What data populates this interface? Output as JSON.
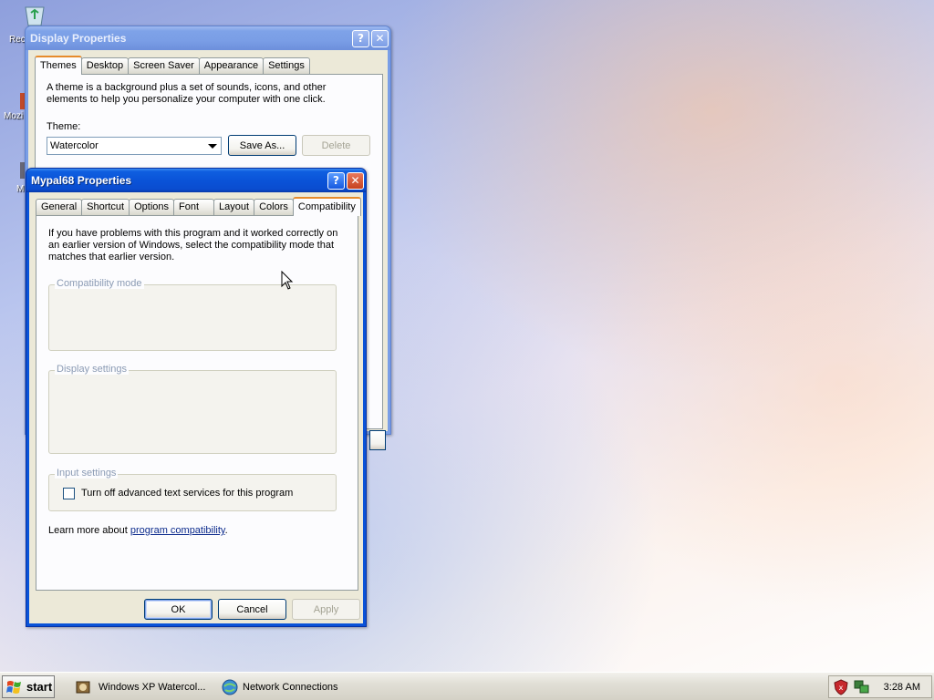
{
  "desktop": {
    "icons": [
      {
        "label": "Rec",
        "icon": "recycle-bin-icon"
      },
      {
        "label": "Mozi",
        "icon": "browser-icon"
      },
      {
        "label": "M",
        "icon": "shortcut-icon"
      }
    ]
  },
  "display_properties": {
    "title": "Display Properties",
    "tabs": [
      "Themes",
      "Desktop",
      "Screen Saver",
      "Appearance",
      "Settings"
    ],
    "selected_tab": "Themes",
    "description": "A theme is a background plus a set of sounds, icons, and other elements to help you personalize your computer with one click.",
    "theme_label": "Theme:",
    "theme_value": "Watercolor",
    "save_as_label": "Save As...",
    "delete_label": "Delete"
  },
  "mypal_properties": {
    "title": "Mypal68 Properties",
    "tabs": [
      "General",
      "Shortcut",
      "Options",
      "Font",
      "Layout",
      "Colors",
      "Compatibility"
    ],
    "selected_tab": "Compatibility",
    "description": "If you have problems with this program and it worked correctly on an earlier version of Windows, select the compatibility mode that matches that earlier version.",
    "compat_mode_title": "Compatibility mode",
    "display_settings_title": "Display settings",
    "input_settings_title": "Input settings",
    "turn_off_text_services": "Turn off advanced text services for this program",
    "turn_off_checked": false,
    "learn_more_prefix": "Learn more about ",
    "learn_more_link": "program compatibility",
    "learn_more_suffix": ".",
    "ok_label": "OK",
    "cancel_label": "Cancel",
    "apply_label": "Apply"
  },
  "taskbar": {
    "start_label": "start",
    "items": [
      {
        "label": "Windows XP Watercol...",
        "icon": "app-icon"
      },
      {
        "label": "Network Connections",
        "icon": "network-icon"
      }
    ],
    "tray_icons": [
      "security-shield-icon",
      "network-status-icon"
    ],
    "clock": "3:28 AM"
  }
}
